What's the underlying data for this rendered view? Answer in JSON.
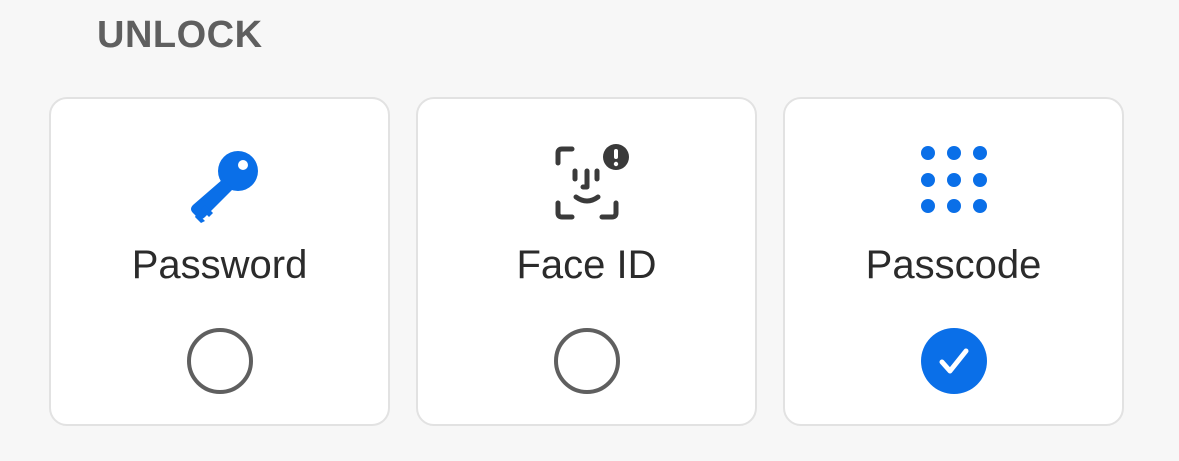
{
  "section": {
    "title": "UNLOCK"
  },
  "accent_color": "#0a6fe8",
  "options": [
    {
      "label": "Password",
      "icon": "key-icon",
      "selected": false
    },
    {
      "label": "Face ID",
      "icon": "face-id-warning-icon",
      "selected": false
    },
    {
      "label": "Passcode",
      "icon": "keypad-icon",
      "selected": true
    }
  ]
}
